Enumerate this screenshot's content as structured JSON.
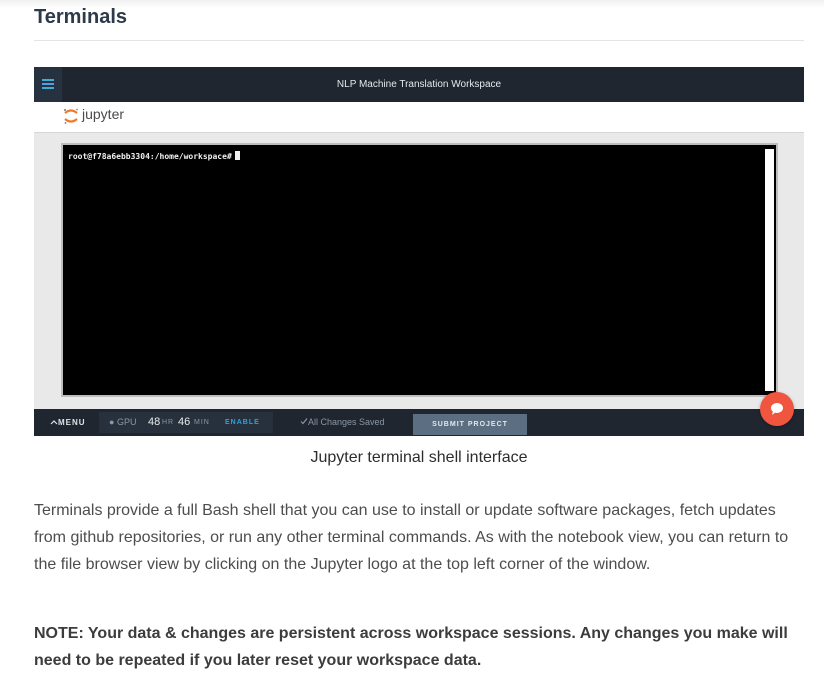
{
  "section": {
    "title": "Terminals"
  },
  "workspace": {
    "header_title": "NLP Machine Translation Workspace",
    "jupyter_name": "jupyter",
    "prompt": "root@f78a6ebb3304:/home/workspace#",
    "footer": {
      "menu_label": "MENU",
      "gpu_label": "GPU",
      "hours": "48",
      "hours_unit": "HR",
      "minutes": "46",
      "minutes_unit": "MIN",
      "enable_label": "ENABLE",
      "saved_status": "All Changes Saved",
      "submit_label": "SUBMIT PROJECT"
    }
  },
  "caption": "Jupyter terminal shell interface",
  "body": {
    "paragraph": "Terminals provide a full Bash shell that you can use to install or update software packages, fetch updates from github repositories, or run any other terminal commands. As with the notebook view, you can return to the file browser view by clicking on the Jupyter logo at the top left corner of the window.",
    "note": "NOTE: Your data & changes are persistent across workspace sessions. Any changes you make will need to be repeated if you later reset your workspace data."
  },
  "icons": {
    "menu": "hamburger-icon",
    "logo": "jupyter-logo",
    "chat": "chat-icon",
    "check": "check-icon",
    "chevron": "chevron-up-icon"
  },
  "colors": {
    "workspace_bar": "#1f2630",
    "accent_blue": "#2ea3d8",
    "chat_orange": "#f0553f",
    "submit_button": "#5c6f82"
  }
}
